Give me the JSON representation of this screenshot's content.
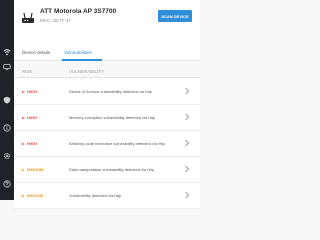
{
  "sidebar": {
    "icons": [
      "wifi-icon",
      "devices-icon",
      "shield-icon",
      "info-icon",
      "settings-icon",
      "help-icon"
    ]
  },
  "header": {
    "device_title": "ATT Motorola AP 3S7700",
    "device_mac": "MAC: 1B:7F:37",
    "scan_button": "SCAN DEVICE"
  },
  "tabs": [
    {
      "label": "Device details",
      "active": false
    },
    {
      "label": "Vulnerabilities",
      "active": true
    }
  ],
  "columns": {
    "risk": "RISK",
    "vulnerability": "VULNERABILITY"
  },
  "rows": [
    {
      "risk": "HIGH",
      "level": "high",
      "description": "Denial of Service vulnerability detected via http"
    },
    {
      "risk": "HIGH",
      "level": "high",
      "description": "Memory corruption vulnerability detected via http"
    },
    {
      "risk": "HIGH",
      "level": "high",
      "description": "Arbitrary code execution vulnerability detected via http"
    },
    {
      "risk": "MEDIUM",
      "level": "medium",
      "description": "Data manipulation vulnerability detected via http"
    },
    {
      "risk": "MEDIUM",
      "level": "medium",
      "description": "Vulnerability detected via http"
    }
  ],
  "colors": {
    "accent": "#2f8fd8",
    "high": "#e24b3b",
    "medium": "#f29a1d",
    "sidebar": "#1d2328"
  }
}
